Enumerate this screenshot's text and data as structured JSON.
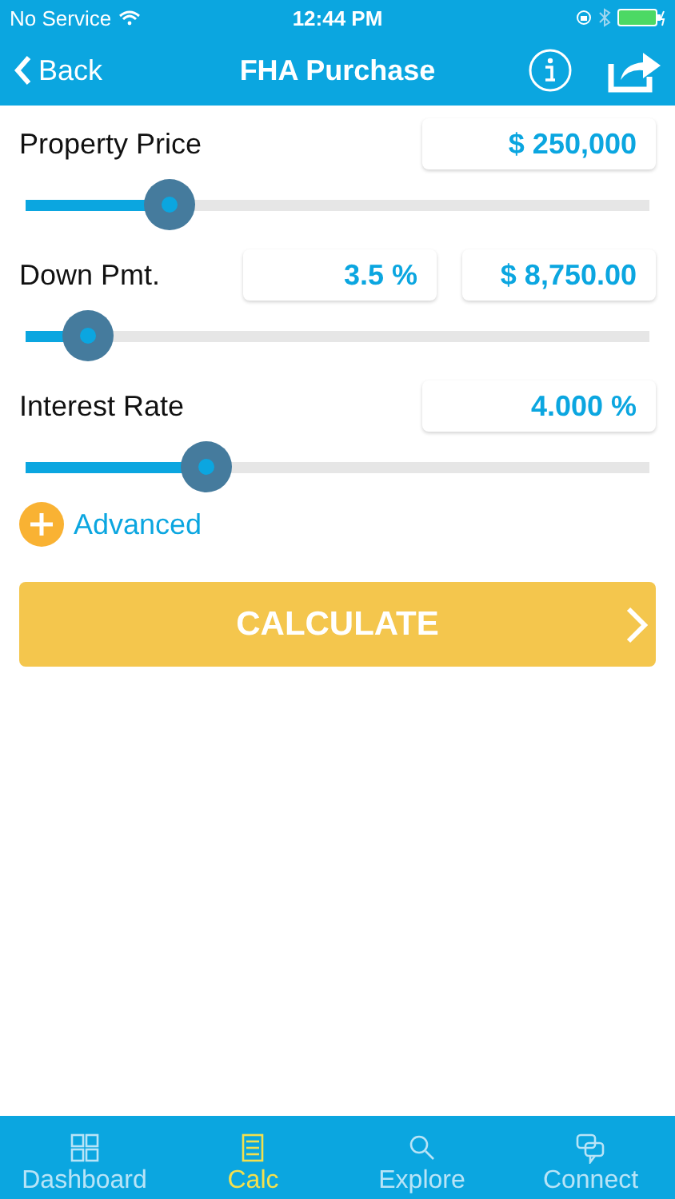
{
  "status_bar": {
    "carrier": "No Service",
    "time": "12:44 PM"
  },
  "nav": {
    "back": "Back",
    "title": "FHA Purchase"
  },
  "inputs": [
    {
      "label": "Property Price",
      "fields": [
        "$ 250,000"
      ],
      "level": 0.23
    },
    {
      "label": "Down Pmt.",
      "fields": [
        "3.5 %",
        "$ 8,750.00"
      ],
      "level": 0.1
    },
    {
      "label": "Interest Rate",
      "fields": [
        "4.000 %"
      ],
      "level": 0.29
    }
  ],
  "advanced": "Advanced",
  "calculate": "CALCULATE",
  "tabs": [
    {
      "label": "Dashboard",
      "selected": false,
      "kind": "grid"
    },
    {
      "label": "Calc",
      "selected": true,
      "kind": "calc"
    },
    {
      "label": "Explore",
      "selected": false,
      "kind": "search"
    },
    {
      "label": "Connect",
      "selected": false,
      "kind": "chat"
    }
  ]
}
